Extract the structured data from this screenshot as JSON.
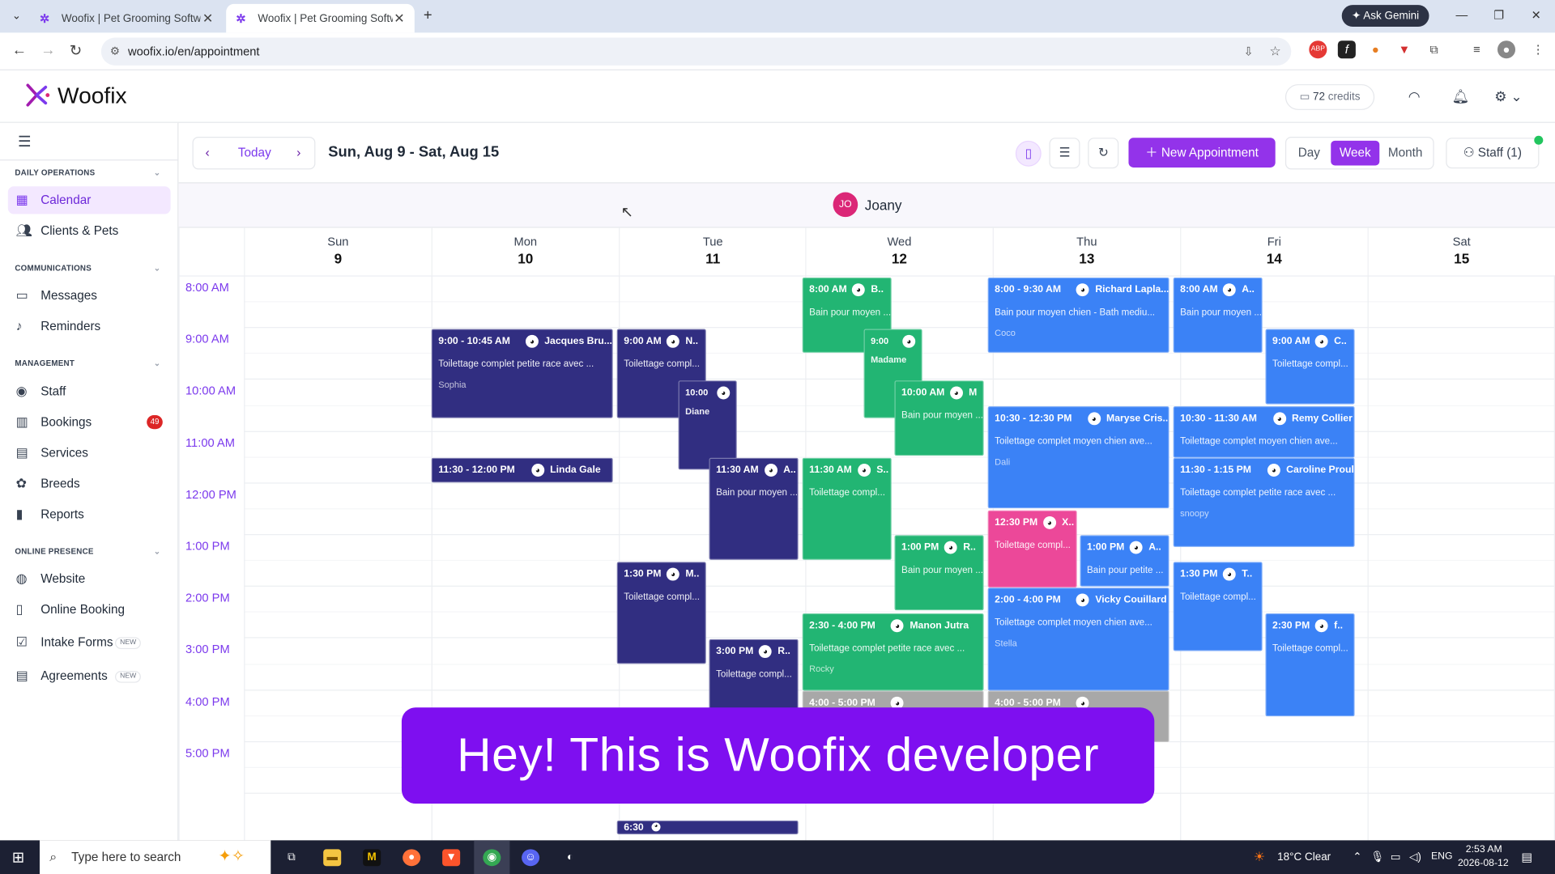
{
  "browser": {
    "tabs": [
      {
        "title": "Woofix | Pet Grooming Software"
      },
      {
        "title": "Woofix | Pet Grooming Software"
      }
    ],
    "url": "woofix.io/en/appointment",
    "gemini": "Ask Gemini"
  },
  "app": {
    "name": "Woofix",
    "credits_count": "72",
    "credits_label": "credits"
  },
  "sidebar": {
    "sections": [
      {
        "title": "DAILY OPERATIONS",
        "items": [
          {
            "label": "Calendar",
            "icon": "calendar-icon",
            "active": true
          },
          {
            "label": "Clients & Pets",
            "icon": "users-icon"
          }
        ]
      },
      {
        "title": "COMMUNICATIONS",
        "items": [
          {
            "label": "Messages",
            "icon": "message-icon"
          },
          {
            "label": "Reminders",
            "icon": "bell-icon"
          }
        ]
      },
      {
        "title": "MANAGEMENT",
        "items": [
          {
            "label": "Staff",
            "icon": "user-circle-icon"
          },
          {
            "label": "Bookings",
            "icon": "book-icon",
            "badge": "49"
          },
          {
            "label": "Services",
            "icon": "briefcase-icon"
          },
          {
            "label": "Breeds",
            "icon": "paw-icon"
          },
          {
            "label": "Reports",
            "icon": "bar-chart-icon"
          }
        ]
      },
      {
        "title": "ONLINE PRESENCE",
        "items": [
          {
            "label": "Website",
            "icon": "globe-icon"
          },
          {
            "label": "Online Booking",
            "icon": "clipboard-icon"
          },
          {
            "label": "Intake Forms",
            "icon": "form-icon",
            "tag": "NEW"
          },
          {
            "label": "Agreements",
            "icon": "document-icon",
            "tag": "NEW"
          }
        ]
      }
    ]
  },
  "toolbar": {
    "today": "Today",
    "range": "Sun, Aug 9 - Sat, Aug 15",
    "new_appointment": "New Appointment",
    "views": [
      "Day",
      "Week",
      "Month"
    ],
    "active_view": "Week",
    "staff": "Staff (1)"
  },
  "staff_row": {
    "initials": "JO",
    "name": "Joany"
  },
  "days": [
    {
      "name": "Sun",
      "num": "9"
    },
    {
      "name": "Mon",
      "num": "10"
    },
    {
      "name": "Tue",
      "num": "11"
    },
    {
      "name": "Wed",
      "num": "12"
    },
    {
      "name": "Thu",
      "num": "13"
    },
    {
      "name": "Fri",
      "num": "14"
    },
    {
      "name": "Sat",
      "num": "15"
    }
  ],
  "hours": [
    "8:00 AM",
    "9:00 AM",
    "10:00 AM",
    "11:00 AM",
    "12:00 PM",
    "1:00 PM",
    "2:00 PM",
    "3:00 PM",
    "4:00 PM",
    "5:00 PM"
  ],
  "events": [
    {
      "day": 1,
      "time": "9:00 - 10:45 AM",
      "client": "Jacques Bru...",
      "service": "Toilettage complet petite race avec ...",
      "pet": "Sophia",
      "color": "navy"
    },
    {
      "day": 1,
      "time": "11:30 - 12:00 PM",
      "client": "Linda Gale",
      "service": "",
      "pet": "",
      "color": "navy"
    },
    {
      "day": 2,
      "time": "9:00 AM",
      "client": "N..",
      "service": "Toilettage compl...",
      "pet": "",
      "color": "navy"
    },
    {
      "day": 2,
      "time": "10:00",
      "client": "",
      "service": "Diane",
      "pet": "",
      "color": "navy"
    },
    {
      "day": 2,
      "time": "11:30 AM",
      "client": "A..",
      "service": "Bain pour moyen ...",
      "pet": "",
      "color": "navy"
    },
    {
      "day": 2,
      "time": "1:30 PM",
      "client": "M..",
      "service": "Toilettage compl...",
      "pet": "",
      "color": "navy"
    },
    {
      "day": 2,
      "time": "3:00 PM",
      "client": "R..",
      "service": "Toilettage compl...",
      "pet": "",
      "color": "navy"
    },
    {
      "day": 2,
      "time": "6:30",
      "client": "",
      "service": "",
      "pet": "",
      "color": "navy"
    },
    {
      "day": 3,
      "time": "8:00 AM",
      "client": "B..",
      "service": "Bain pour moyen ...",
      "pet": "",
      "color": "green"
    },
    {
      "day": 3,
      "time": "9:00",
      "client": "",
      "service": "Madame",
      "pet": "",
      "color": "green"
    },
    {
      "day": 3,
      "time": "10:00 AM",
      "client": "M",
      "service": "Bain pour moyen ...",
      "pet": "",
      "color": "green"
    },
    {
      "day": 3,
      "time": "11:30 AM",
      "client": "S..",
      "service": "Toilettage compl...",
      "pet": "",
      "color": "green"
    },
    {
      "day": 3,
      "time": "1:00 PM",
      "client": "R..",
      "service": "Bain pour moyen ...",
      "pet": "",
      "color": "green"
    },
    {
      "day": 3,
      "time": "2:30 - 4:00 PM",
      "client": "Manon Jutra",
      "service": "Toilettage complet petite race avec ...",
      "pet": "Rocky",
      "color": "green"
    },
    {
      "day": 3,
      "time": "4:00 - 5:00 PM",
      "client": "",
      "service": "",
      "pet": "",
      "color": "gray"
    },
    {
      "day": 4,
      "time": "8:00 - 9:30 AM",
      "client": "Richard Lapla...",
      "service": "Bain pour moyen chien - Bath mediu...",
      "pet": "Coco",
      "color": "blue"
    },
    {
      "day": 4,
      "time": "10:30 - 12:30 PM",
      "client": "Maryse Cris...",
      "service": "Toilettage complet moyen chien ave...",
      "pet": "Dali",
      "color": "blue"
    },
    {
      "day": 4,
      "time": "12:30 PM",
      "client": "X..",
      "service": "Toilettage compl...",
      "pet": "",
      "color": "pink"
    },
    {
      "day": 4,
      "time": "1:00 PM",
      "client": "A..",
      "service": "Bain pour petite ...",
      "pet": "",
      "color": "blue"
    },
    {
      "day": 4,
      "time": "2:00 - 4:00 PM",
      "client": "Vicky Couillard",
      "service": "Toilettage complet moyen chien ave...",
      "pet": "Stella",
      "color": "blue"
    },
    {
      "day": 4,
      "time": "4:00 - 5:00 PM",
      "client": "",
      "service": "",
      "pet": "",
      "color": "gray"
    },
    {
      "day": 5,
      "time": "8:00 AM",
      "client": "A..",
      "service": "Bain pour moyen ...",
      "pet": "",
      "color": "blue"
    },
    {
      "day": 5,
      "time": "9:00 AM",
      "client": "C..",
      "service": "Toilettage compl...",
      "pet": "",
      "color": "blue"
    },
    {
      "day": 5,
      "time": "10:30 - 11:30 AM",
      "client": "Remy Collier",
      "service": "Toilettage complet moyen chien ave...",
      "pet": "",
      "color": "blue"
    },
    {
      "day": 5,
      "time": "11:30 - 1:15 PM",
      "client": "Caroline Proulx",
      "service": "Toilettage complet petite race avec ...",
      "pet": "snoopy",
      "color": "blue"
    },
    {
      "day": 5,
      "time": "1:30 PM",
      "client": "T..",
      "service": "Toilettage compl...",
      "pet": "",
      "color": "blue"
    },
    {
      "day": 5,
      "time": "2:30 PM",
      "client": "f..",
      "service": "Toilettage compl...",
      "pet": "",
      "color": "blue"
    }
  ],
  "banner": "Hey! This is Woofix developer",
  "taskbar": {
    "search": "Type here to search",
    "weather": "18°C  Clear",
    "lang": "ENG",
    "time": "2:53 AM",
    "date": "2026-08-12"
  }
}
